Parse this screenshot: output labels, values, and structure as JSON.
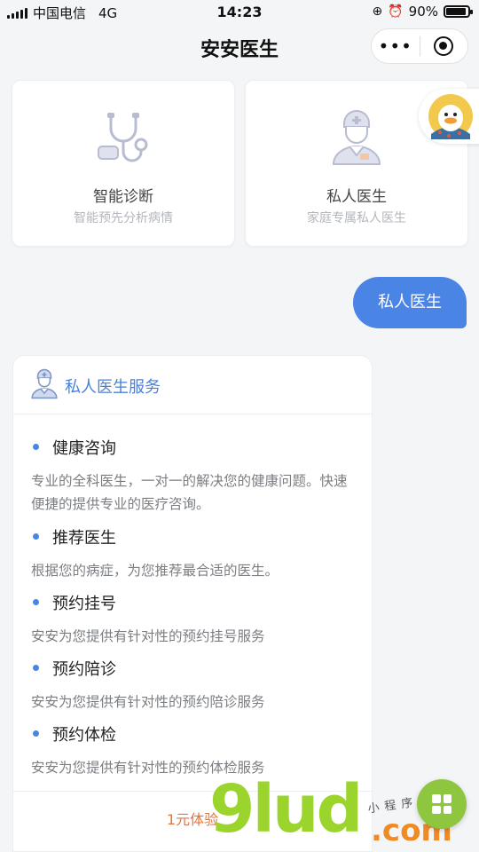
{
  "status_bar": {
    "carrier": "中国电信",
    "network": "4G",
    "time": "14:23",
    "battery": "90%"
  },
  "nav": {
    "title": "安安医生",
    "more_label": "•••"
  },
  "cards": [
    {
      "title": "智能诊断",
      "subtitle": "智能预先分析病情",
      "icon": "stethoscope-icon"
    },
    {
      "title": "私人医生",
      "subtitle": "家庭专属私人医生",
      "icon": "doctor-icon"
    }
  ],
  "chat": {
    "user_message": "私人医生"
  },
  "reply": {
    "title": "私人医生服务",
    "services": [
      {
        "name": "健康咨询",
        "desc": "专业的全科医生，一对一的解决您的健康问题。快速便捷的提供专业的医疗咨询。"
      },
      {
        "name": "推荐医生",
        "desc": "根据您的病症，为您推荐最合适的医生。"
      },
      {
        "name": "预约挂号",
        "desc": "安安为您提供有针对性的预约挂号服务"
      },
      {
        "name": "预约陪诊",
        "desc": "安安为您提供有针对性的预约陪诊服务"
      },
      {
        "name": "预约体检",
        "desc": "安安为您提供有针对性的预约体检服务"
      }
    ],
    "cta": "1元体验"
  },
  "watermark": {
    "brand": "9lud",
    "tld": ".com",
    "handwriting": "小程序商店"
  },
  "colors": {
    "accent": "#4a85e6",
    "cta": "#e67339",
    "fab": "#8ec63f"
  }
}
